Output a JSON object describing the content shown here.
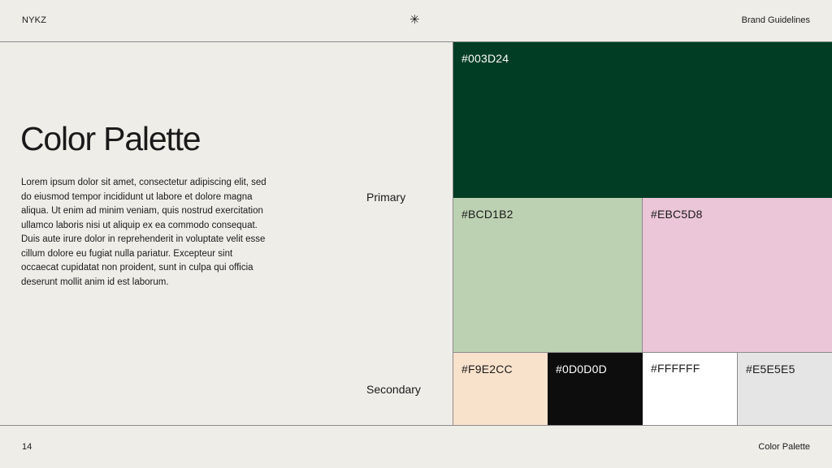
{
  "header": {
    "brand": "NYKZ",
    "star_icon": "✳",
    "right": "Brand Guidelines"
  },
  "main": {
    "title": "Color Palette",
    "body": "Lorem ipsum dolor sit amet, consectetur adipiscing elit, sed do eiusmod tempor incididunt ut labore et dolore magna aliqua. Ut enim ad minim veniam, quis nostrud exercitation ullamco laboris nisi ut aliquip ex ea commodo consequat. Duis aute irure dolor in reprehenderit in voluptate velit esse cillum dolore eu fugiat nulla pariatur. Excepteur sint occaecat cupidatat non proident, sunt in culpa qui officia deserunt mollit anim id est laborum."
  },
  "palette": {
    "primary_label": "Primary",
    "secondary_label": "Secondary",
    "primary": [
      {
        "hex": "#003D24"
      },
      {
        "hex": "#BCD1B2"
      },
      {
        "hex": "#EBC5D8"
      }
    ],
    "secondary": [
      {
        "hex": "#F9E2CC"
      },
      {
        "hex": "#0D0D0D"
      },
      {
        "hex": "#FFFFFF"
      },
      {
        "hex": "#E5E5E5"
      }
    ]
  },
  "footer": {
    "page_number": "14",
    "right": "Color Palette"
  }
}
